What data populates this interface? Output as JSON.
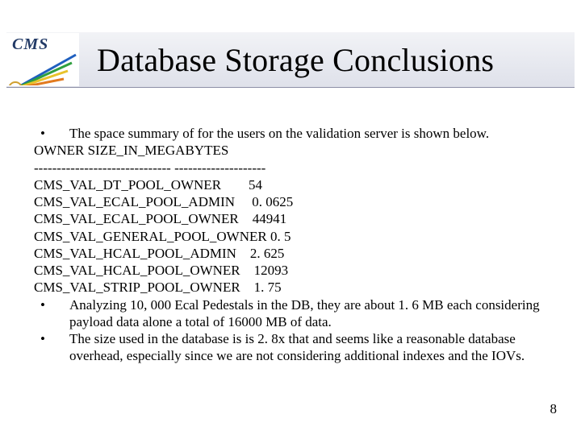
{
  "logo": {
    "label": "CMS"
  },
  "title": "Database Storage Conclusions",
  "lines": {
    "bullet1": "The space summary of for the users on the validation server is shown below.",
    "header": "OWNER SIZE_IN_MEGABYTES",
    "sep": "------------------------------ --------------------",
    "r1": "CMS_VAL_DT_POOL_OWNER        54",
    "r2": "CMS_VAL_ECAL_POOL_ADMIN     0. 0625",
    "r3": "CMS_VAL_ECAL_POOL_OWNER    44941",
    "r4": "CMS_VAL_GENERAL_POOL_OWNER 0. 5",
    "r5": "CMS_VAL_HCAL_POOL_ADMIN    2. 625",
    "r6": "CMS_VAL_HCAL_POOL_OWNER    12093",
    "r7": "CMS_VAL_STRIP_POOL_OWNER    1. 75",
    "bullet2": "Analyzing 10, 000 Ecal     Pedestals in the DB, they are about 1. 6 MB each considering payload data alone a total of 16000 MB of data.",
    "bullet3": "The size used in the database is is 2. 8x that and seems like a reasonable database overhead, especially since we are not considering additional indexes and the IOVs."
  },
  "page_number": "8",
  "chart_data": {
    "type": "table",
    "title": "OWNER SIZE_IN_MEGABYTES",
    "columns": [
      "OWNER",
      "SIZE_IN_MEGABYTES"
    ],
    "rows": [
      [
        "CMS_VAL_DT_POOL_OWNER",
        54
      ],
      [
        "CMS_VAL_ECAL_POOL_ADMIN",
        0.0625
      ],
      [
        "CMS_VAL_ECAL_POOL_OWNER",
        44941
      ],
      [
        "CMS_VAL_GENERAL_POOL_OWNER",
        0.5
      ],
      [
        "CMS_VAL_HCAL_POOL_ADMIN",
        2.625
      ],
      [
        "CMS_VAL_HCAL_POOL_OWNER",
        12093
      ],
      [
        "CMS_VAL_STRIP_POOL_OWNER",
        1.75
      ]
    ]
  }
}
